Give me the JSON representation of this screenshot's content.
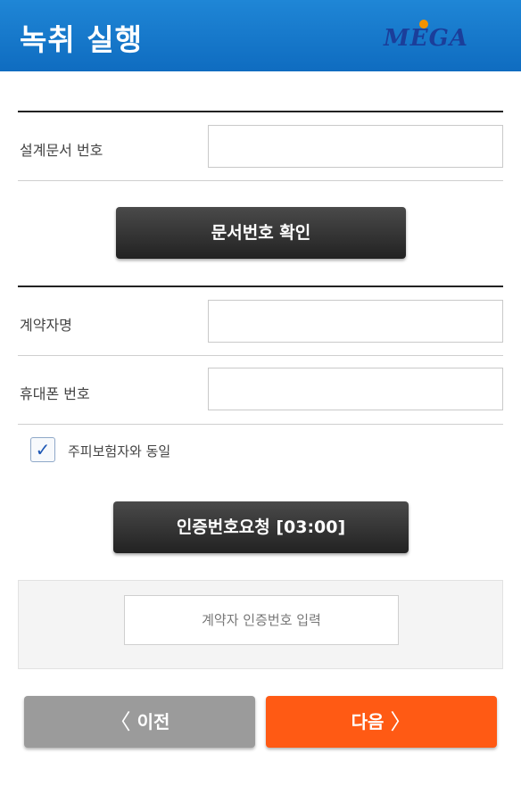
{
  "header": {
    "title": "녹취 실행",
    "logo_text": "MEGA"
  },
  "design_doc": {
    "label": "설계문서 번호",
    "value": ""
  },
  "confirm_button": {
    "label": "문서번호 확인"
  },
  "contractor_name": {
    "label": "계약자명",
    "value": ""
  },
  "phone": {
    "label": "휴대폰 번호",
    "value": ""
  },
  "same_insured": {
    "label": "주피보험자와 동일",
    "checked": true,
    "check_glyph": "✓"
  },
  "auth_request_button": {
    "label": "인증번호요청 [03:00]"
  },
  "auth_code": {
    "placeholder": "계약자 인증번호 입력"
  },
  "footer": {
    "prev_label": "이전",
    "prev_icon": "〈",
    "next_label": "다음",
    "next_icon": "〉",
    "prev_color": "#9b9b9b",
    "next_color": "#ff5a14"
  },
  "colors": {
    "header_blue": "#1779cc",
    "accent_orange": "#ff5a14"
  }
}
